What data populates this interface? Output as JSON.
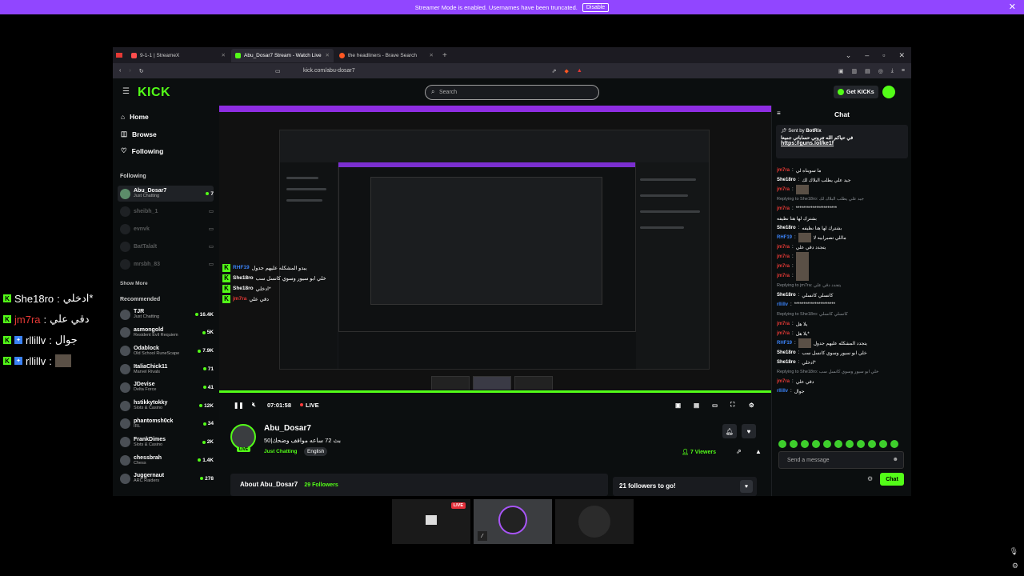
{
  "banner": {
    "text": "Streamer Mode is enabled. Usernames have been truncated.",
    "disable_label": "Disable",
    "close": "✕"
  },
  "overlay_chat": [
    {
      "user": "She18ro",
      "message": "ادخلي*",
      "color": "#ffffff"
    },
    {
      "user": "jm7ra",
      "message": "دقي علي",
      "color": "#e53935"
    },
    {
      "user": "rllillv",
      "message": "جوال",
      "color": "#ffffff"
    },
    {
      "user": "rllillv",
      "message": "",
      "color": "#ffffff"
    }
  ],
  "browser": {
    "tabs": [
      {
        "label": "9-1-1 | StreameX",
        "fav_color": "#e53935"
      },
      {
        "label": "Abu_Dosar7 Stream - Watch Live",
        "fav_color": "#53fc18"
      },
      {
        "label": "the headliners - Brave Search",
        "fav_color": "#ff5722"
      }
    ],
    "url": "kick.com/abu-dosar7"
  },
  "kick": {
    "logo": "KICK",
    "search_placeholder": "Search",
    "get_kicks": "Get KICKs",
    "nav": [
      {
        "label": "Home",
        "icon": "⌂"
      },
      {
        "label": "Browse",
        "icon": "◫"
      },
      {
        "label": "Following",
        "icon": "♡"
      }
    ],
    "following_title": "Following",
    "following": [
      {
        "name": "Abu_Dosar7",
        "sub": "Just Chatting",
        "count": "7",
        "live": true
      },
      {
        "name": "sheibh_1",
        "sub": "",
        "count": "",
        "live": false
      },
      {
        "name": "evnvk",
        "sub": "",
        "count": "",
        "live": false
      },
      {
        "name": "BatTalalt",
        "sub": "",
        "count": "",
        "live": false
      },
      {
        "name": "mrsbh_83",
        "sub": "",
        "count": "",
        "live": false
      }
    ],
    "show_more": "Show More",
    "recommended_title": "Recommended",
    "recommended": [
      {
        "name": "TJR",
        "sub": "Just Chatting",
        "count": "16.4K"
      },
      {
        "name": "asmongold",
        "sub": "Resident Evil Requiem",
        "count": "5K"
      },
      {
        "name": "Odablock",
        "sub": "Old School RuneScape",
        "count": "7.9K"
      },
      {
        "name": "ItaliaChick11",
        "sub": "Marvel Rivals",
        "count": "71"
      },
      {
        "name": "JDevise",
        "sub": "Delta Force",
        "count": "41"
      },
      {
        "name": "hstikkytokky",
        "sub": "Slots & Casino",
        "count": "12K"
      },
      {
        "name": "phantomsh0ck",
        "sub": "IRL",
        "count": "34"
      },
      {
        "name": "FrankDimes",
        "sub": "Slots & Casino",
        "count": "2K"
      },
      {
        "name": "chessbrah",
        "sub": "Chess",
        "count": "1.4K"
      },
      {
        "name": "Juggernaut",
        "sub": "ARC Raiders",
        "count": "278"
      }
    ],
    "player": {
      "time": "07:01:58",
      "live": "LIVE",
      "inner_chat": [
        {
          "user": "RHF19",
          "message": "يبدو المشكله عليهم جدول"
        },
        {
          "user": "She18ro",
          "message": "خلي ابو سيور وسوي كانسل سب"
        },
        {
          "user": "She18ro",
          "message": "ادخلي*"
        },
        {
          "user": "jm7ra",
          "message": "دقي علي"
        }
      ]
    },
    "stream": {
      "name": "Abu_Dosar7",
      "title": "بث 72 ساعه مواقف وضحك|50",
      "category": "Just Chatting",
      "language": "English",
      "viewers": "7 Viewers",
      "live_badge": "LIVE"
    },
    "about": {
      "title": "About Abu_Dosar7",
      "followers": "29 Followers"
    },
    "goal": "21 followers to go!",
    "chat": {
      "title": "Chat",
      "pinned_sender": "Sent by",
      "pinned_user": "BotRix",
      "pinned_text": "في حياكم الله تتروني حساباتي جميعا",
      "pinned_link": "https://guns.lol/ke1f",
      "messages": [
        {
          "user": "jm7ra",
          "text": "ما سويناه لي",
          "reply": false,
          "color": "#e53935"
        },
        {
          "user": "She18ro",
          "text": "جيد علي يطلب البلاك لك",
          "reply": false,
          "color": "#ffffff"
        },
        {
          "user": "jm7ra",
          "text": "",
          "reply": false,
          "color": "#e53935",
          "emote": true
        },
        {
          "user": "",
          "text": "Replying to She18ro: جيد علي يطلب البلاك لك",
          "reply": true,
          "color": "#8a8f94"
        },
        {
          "user": "jm7ra",
          "text": "**********************",
          "reply": false,
          "color": "#e53935"
        },
        {
          "user": "",
          "text": "بشترك لها هنا نظيفه",
          "reply": false,
          "color": "#ffffff"
        },
        {
          "user": "She18ro",
          "text": "بشترك لها هنا نظيفه",
          "reply": false,
          "color": "#ffffff"
        },
        {
          "user": "RHF19",
          "text": "ماللي تصبرابيه لا",
          "reply": false,
          "color": "#3b82f6",
          "emote": true
        },
        {
          "user": "jm7ra",
          "text": "يتجدد دقي علي",
          "reply": false,
          "color": "#e53935"
        },
        {
          "user": "jm7ra",
          "text": "",
          "reply": false,
          "color": "#e53935",
          "emote": true
        },
        {
          "user": "jm7ra",
          "text": "",
          "reply": false,
          "color": "#e53935",
          "emote": true
        },
        {
          "user": "jm7ra",
          "text": "",
          "reply": false,
          "color": "#e53935",
          "emote": true
        },
        {
          "user": "",
          "text": "Replying to jm7ra: يتجدد دقي علي",
          "reply": true,
          "color": "#8a8f94"
        },
        {
          "user": "She18ro",
          "text": "كانسلي كانسلي",
          "reply": false,
          "color": "#ffffff"
        },
        {
          "user": "rllillv",
          "text": "**********************",
          "reply": false,
          "color": "#3b82f6"
        },
        {
          "user": "",
          "text": "Replying to She18ro: كانسلي كانسلي",
          "reply": true,
          "color": "#8a8f94"
        },
        {
          "user": "jm7ra",
          "text": "يلا هل",
          "reply": false,
          "color": "#e53935"
        },
        {
          "user": "jm7ra",
          "text": "يلا هل*",
          "reply": false,
          "color": "#e53935"
        },
        {
          "user": "RHF19",
          "text": "يتجدد المشكله عليهم جدول",
          "reply": false,
          "color": "#3b82f6",
          "emote": true
        },
        {
          "user": "She18ro",
          "text": "خلي ابو سيور وسوي كانسل سب",
          "reply": false,
          "color": "#ffffff"
        },
        {
          "user": "She18ro",
          "text": "ادخلي*",
          "reply": false,
          "color": "#ffffff"
        },
        {
          "user": "",
          "text": "Replying to She18ro: خلي ابو سيور وسوي كانسل سب",
          "reply": true,
          "color": "#8a8f94"
        },
        {
          "user": "jm7ra",
          "text": "دقي علي",
          "reply": false,
          "color": "#e53935"
        },
        {
          "user": "rllillv",
          "text": "جوال",
          "reply": false,
          "color": "#3b82f6"
        }
      ],
      "send_placeholder": "Send a message",
      "send_label": "Chat"
    }
  },
  "participants": {
    "live_label": "LIVE"
  }
}
